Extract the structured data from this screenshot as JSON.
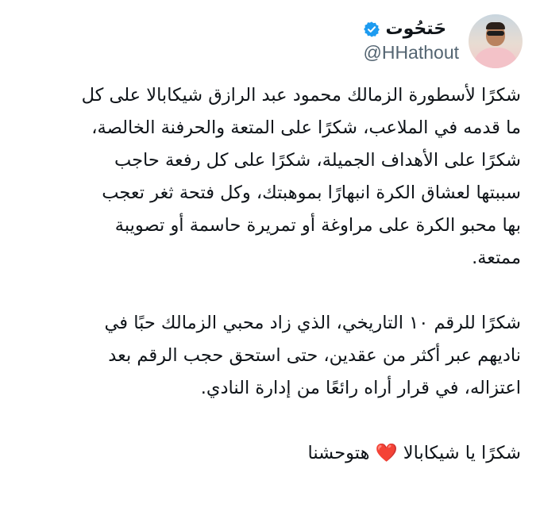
{
  "author": {
    "display_name": "حَتحُوت",
    "handle": "@HHathout",
    "verified": true,
    "verified_badge_color": "#1d9bf0",
    "avatar": "profile-photo"
  },
  "menu_icon": "more-options-icon",
  "tweet": {
    "paragraphs": [
      [
        "شكرًا لأسطورة الزمالك محمود عبد الرازق شيكابالا على كل",
        "ما قدمه في الملاعب، شكرًا على المتعة والحرفنة الخالصة،",
        "شكرًا على الأهداف الجميلة، شكرًا على كل رفعة حاجب",
        "سببتها لعشاق الكرة انبهارًا بموهبتك، وكل فتحة ثغر تعجب",
        "بها محبو الكرة على مراوغة أو تمريرة حاسمة أو تصويبة",
        "ممتعة."
      ],
      [
        "شكرًا للرقم ١٠ التاريخي، الذي زاد محبي الزمالك حبًا في",
        "ناديهم عبر أكثر من عقدين، حتى استحق حجب الرقم بعد",
        "اعتزاله، في قرار أراه رائعًا من إدارة النادي."
      ],
      [
        "شكرًا يا شيكابالا ❤️ هتوحشنا"
      ]
    ]
  }
}
